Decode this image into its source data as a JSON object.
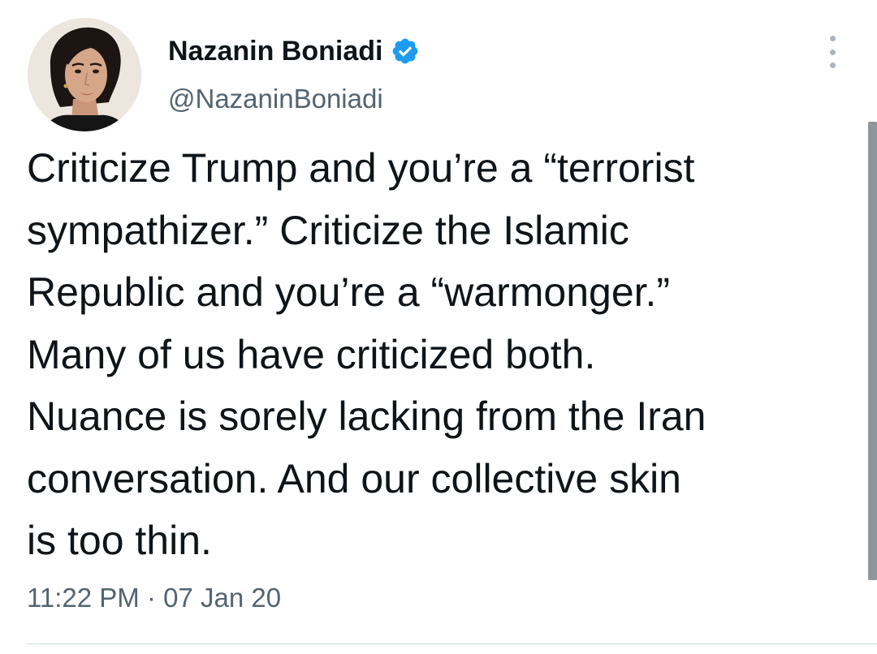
{
  "user": {
    "display_name": "Nazanin Boniadi",
    "handle": "@NazaninBoniadi",
    "verified": true
  },
  "tweet": {
    "text_lines": [
      "Criticize Trump and you’re a “terrorist",
      "sympathizer.” Criticize the Islamic",
      "Republic and you’re a “warmonger.”",
      "Many of us have criticized both.",
      "Nuance is sorely lacking from the Iran",
      "conversation. And our collective skin",
      "is too thin."
    ],
    "time": "11:22 PM",
    "separator": "·",
    "date": "07 Jan 20"
  },
  "icons": {
    "verified": "verified-badge-icon",
    "more": "more-options-icon"
  },
  "colors": {
    "verified_blue": "#1d9bf0",
    "text": "#0f1419",
    "secondary_text": "#536471",
    "divider": "#cfd9de"
  }
}
